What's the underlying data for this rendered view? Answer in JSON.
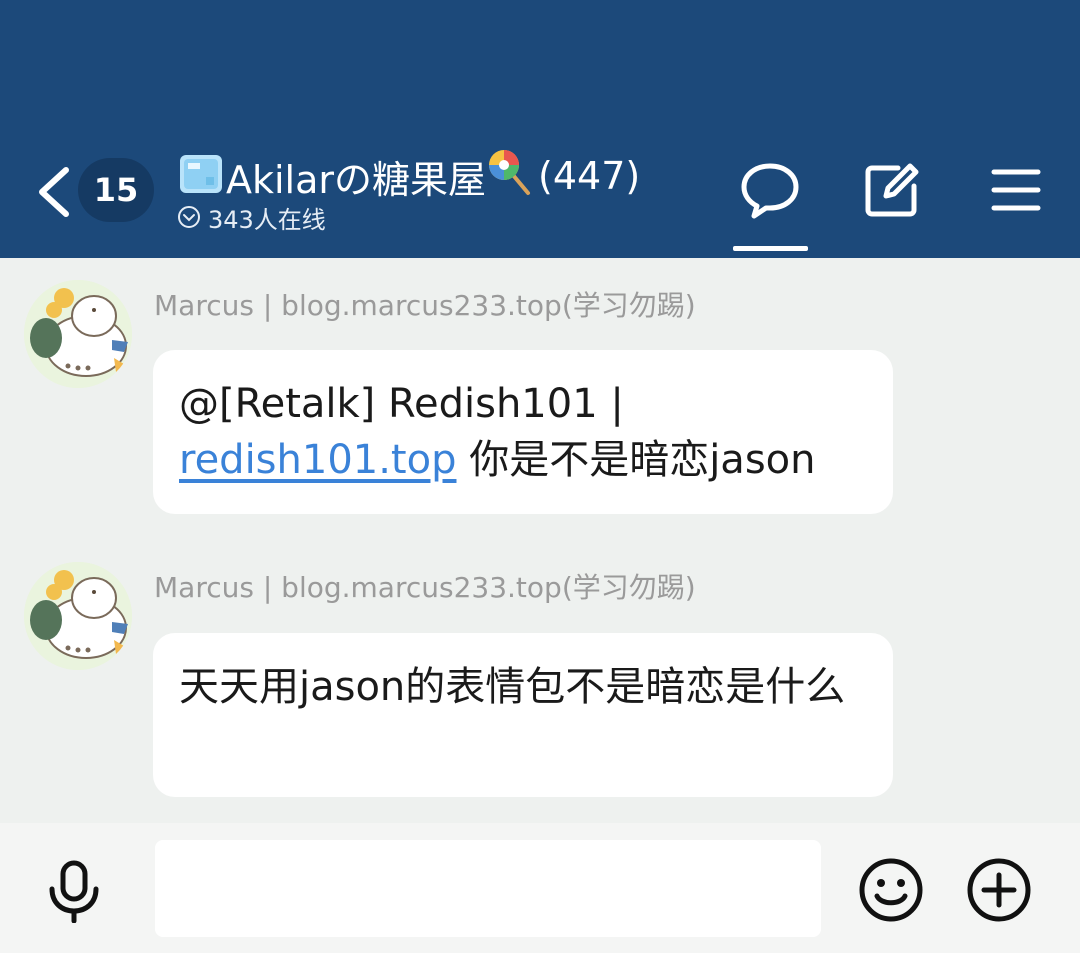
{
  "header": {
    "unread_count": "15",
    "group_name": "Akilarの糖果屋",
    "member_count": "(447)",
    "online_text": "343人在线",
    "icons": [
      "back-arrow-icon",
      "ice-cube-icon",
      "lollipop-icon",
      "online-circle-icon",
      "chat-bubble-icon",
      "edit-icon",
      "menu-icon"
    ],
    "colors": {
      "header_bg": "#1c497a",
      "badge_bg": "#153a63",
      "link": "#3a82d8"
    }
  },
  "messages": [
    {
      "sender": "Marcus | blog.marcus233.top(学习勿踢)",
      "text_before_link": "@[Retalk] Redish101 | ",
      "link": "redish101.top",
      "text_after_link": " 你是不是暗恋jason"
    },
    {
      "sender": "Marcus | blog.marcus233.top(学习勿踢)",
      "text": "天天用jason的表情包不是暗恋是什么"
    }
  ],
  "input_bar": {
    "placeholder": "",
    "value": "",
    "icons": [
      "microphone-icon",
      "emoji-icon",
      "plus-icon"
    ]
  }
}
